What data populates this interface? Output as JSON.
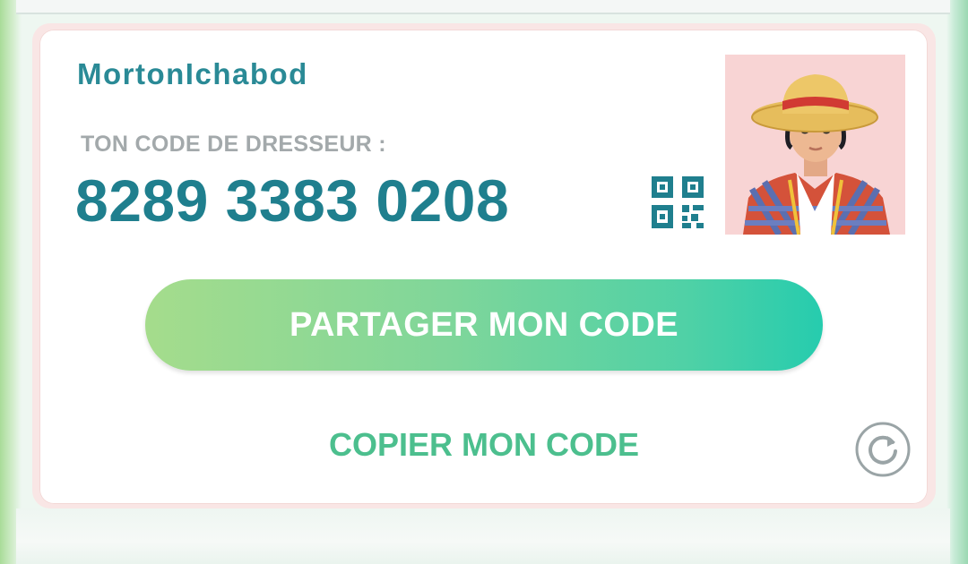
{
  "trainer_card": {
    "username": "MortonIchabod",
    "code_label": "TON CODE DE DRESSEUR :",
    "code_value": "8289 3383 0208"
  },
  "actions": {
    "share_label": "PARTAGER MON CODE",
    "copy_label": "COPIER MON CODE"
  },
  "icons": {
    "qr": "qr-code-icon",
    "refresh": "refresh-icon",
    "avatar": "trainer-avatar"
  },
  "colors": {
    "username": "#2a8a96",
    "code": "#1f7f8e",
    "label": "#a3a9ab",
    "share_gradient_start": "#a5dc8c",
    "share_gradient_end": "#26ccae",
    "copy_text": "#4cbf8e",
    "avatar_background": "#f8d4d4",
    "card_border": "#f9e6e5"
  }
}
